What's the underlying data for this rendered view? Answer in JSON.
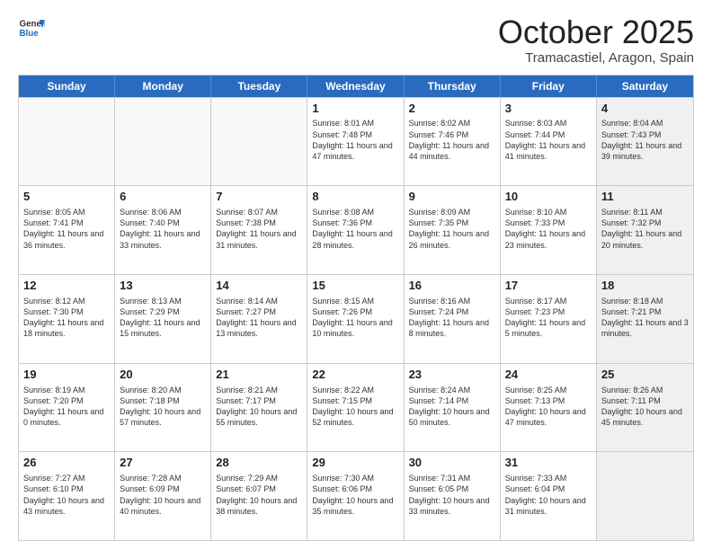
{
  "header": {
    "logo_general": "General",
    "logo_blue": "Blue",
    "month": "October 2025",
    "location": "Tramacastiel, Aragon, Spain"
  },
  "days_of_week": [
    "Sunday",
    "Monday",
    "Tuesday",
    "Wednesday",
    "Thursday",
    "Friday",
    "Saturday"
  ],
  "rows": [
    [
      {
        "day": "",
        "text": "",
        "empty": true
      },
      {
        "day": "",
        "text": "",
        "empty": true
      },
      {
        "day": "",
        "text": "",
        "empty": true
      },
      {
        "day": "1",
        "text": "Sunrise: 8:01 AM\nSunset: 7:48 PM\nDaylight: 11 hours and 47 minutes."
      },
      {
        "day": "2",
        "text": "Sunrise: 8:02 AM\nSunset: 7:46 PM\nDaylight: 11 hours and 44 minutes."
      },
      {
        "day": "3",
        "text": "Sunrise: 8:03 AM\nSunset: 7:44 PM\nDaylight: 11 hours and 41 minutes."
      },
      {
        "day": "4",
        "text": "Sunrise: 8:04 AM\nSunset: 7:43 PM\nDaylight: 11 hours and 39 minutes.",
        "shaded": true
      }
    ],
    [
      {
        "day": "5",
        "text": "Sunrise: 8:05 AM\nSunset: 7:41 PM\nDaylight: 11 hours and 36 minutes."
      },
      {
        "day": "6",
        "text": "Sunrise: 8:06 AM\nSunset: 7:40 PM\nDaylight: 11 hours and 33 minutes."
      },
      {
        "day": "7",
        "text": "Sunrise: 8:07 AM\nSunset: 7:38 PM\nDaylight: 11 hours and 31 minutes."
      },
      {
        "day": "8",
        "text": "Sunrise: 8:08 AM\nSunset: 7:36 PM\nDaylight: 11 hours and 28 minutes."
      },
      {
        "day": "9",
        "text": "Sunrise: 8:09 AM\nSunset: 7:35 PM\nDaylight: 11 hours and 26 minutes."
      },
      {
        "day": "10",
        "text": "Sunrise: 8:10 AM\nSunset: 7:33 PM\nDaylight: 11 hours and 23 minutes."
      },
      {
        "day": "11",
        "text": "Sunrise: 8:11 AM\nSunset: 7:32 PM\nDaylight: 11 hours and 20 minutes.",
        "shaded": true
      }
    ],
    [
      {
        "day": "12",
        "text": "Sunrise: 8:12 AM\nSunset: 7:30 PM\nDaylight: 11 hours and 18 minutes."
      },
      {
        "day": "13",
        "text": "Sunrise: 8:13 AM\nSunset: 7:29 PM\nDaylight: 11 hours and 15 minutes."
      },
      {
        "day": "14",
        "text": "Sunrise: 8:14 AM\nSunset: 7:27 PM\nDaylight: 11 hours and 13 minutes."
      },
      {
        "day": "15",
        "text": "Sunrise: 8:15 AM\nSunset: 7:26 PM\nDaylight: 11 hours and 10 minutes."
      },
      {
        "day": "16",
        "text": "Sunrise: 8:16 AM\nSunset: 7:24 PM\nDaylight: 11 hours and 8 minutes."
      },
      {
        "day": "17",
        "text": "Sunrise: 8:17 AM\nSunset: 7:23 PM\nDaylight: 11 hours and 5 minutes."
      },
      {
        "day": "18",
        "text": "Sunrise: 8:18 AM\nSunset: 7:21 PM\nDaylight: 11 hours and 3 minutes.",
        "shaded": true
      }
    ],
    [
      {
        "day": "19",
        "text": "Sunrise: 8:19 AM\nSunset: 7:20 PM\nDaylight: 11 hours and 0 minutes."
      },
      {
        "day": "20",
        "text": "Sunrise: 8:20 AM\nSunset: 7:18 PM\nDaylight: 10 hours and 57 minutes."
      },
      {
        "day": "21",
        "text": "Sunrise: 8:21 AM\nSunset: 7:17 PM\nDaylight: 10 hours and 55 minutes."
      },
      {
        "day": "22",
        "text": "Sunrise: 8:22 AM\nSunset: 7:15 PM\nDaylight: 10 hours and 52 minutes."
      },
      {
        "day": "23",
        "text": "Sunrise: 8:24 AM\nSunset: 7:14 PM\nDaylight: 10 hours and 50 minutes."
      },
      {
        "day": "24",
        "text": "Sunrise: 8:25 AM\nSunset: 7:13 PM\nDaylight: 10 hours and 47 minutes."
      },
      {
        "day": "25",
        "text": "Sunrise: 8:26 AM\nSunset: 7:11 PM\nDaylight: 10 hours and 45 minutes.",
        "shaded": true
      }
    ],
    [
      {
        "day": "26",
        "text": "Sunrise: 7:27 AM\nSunset: 6:10 PM\nDaylight: 10 hours and 43 minutes."
      },
      {
        "day": "27",
        "text": "Sunrise: 7:28 AM\nSunset: 6:09 PM\nDaylight: 10 hours and 40 minutes."
      },
      {
        "day": "28",
        "text": "Sunrise: 7:29 AM\nSunset: 6:07 PM\nDaylight: 10 hours and 38 minutes."
      },
      {
        "day": "29",
        "text": "Sunrise: 7:30 AM\nSunset: 6:06 PM\nDaylight: 10 hours and 35 minutes."
      },
      {
        "day": "30",
        "text": "Sunrise: 7:31 AM\nSunset: 6:05 PM\nDaylight: 10 hours and 33 minutes."
      },
      {
        "day": "31",
        "text": "Sunrise: 7:33 AM\nSunset: 6:04 PM\nDaylight: 10 hours and 31 minutes."
      },
      {
        "day": "",
        "text": "",
        "empty": true,
        "shaded": true
      }
    ]
  ]
}
